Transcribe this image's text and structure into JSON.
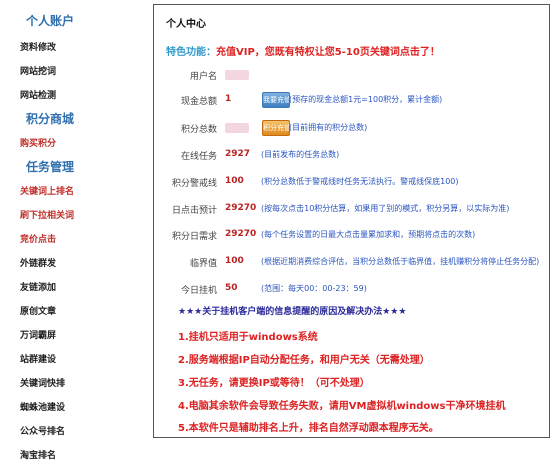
{
  "sidebar": {
    "sections": [
      {
        "title": "个人账户",
        "items": [
          {
            "label": "资料修改",
            "highlight": false
          },
          {
            "label": "网站挖词",
            "highlight": false
          },
          {
            "label": "网站检测",
            "highlight": false
          }
        ]
      },
      {
        "title": "积分商城",
        "items": [
          {
            "label": "购买积分",
            "highlight": true
          }
        ]
      },
      {
        "title": "任务管理",
        "items": [
          {
            "label": "关键词上排名",
            "highlight": true
          },
          {
            "label": "刷下拉相关词",
            "highlight": true
          },
          {
            "label": "竞价点击",
            "highlight": true
          },
          {
            "label": "外链群发",
            "highlight": false
          },
          {
            "label": "友链添加",
            "highlight": false
          },
          {
            "label": "原创文章",
            "highlight": false
          },
          {
            "label": "万词霸屏",
            "highlight": false
          },
          {
            "label": "站群建设",
            "highlight": false
          },
          {
            "label": "关键词快排",
            "highlight": false
          },
          {
            "label": "蜘蛛池建设",
            "highlight": false
          },
          {
            "label": "公众号排名",
            "highlight": false
          },
          {
            "label": "淘宝排名",
            "highlight": false
          }
        ]
      }
    ]
  },
  "panel": {
    "title": "个人中心",
    "feature_label": "特色功能：",
    "feature_text": "充值VIP，您既有特权让您5-10页关键词点击了！",
    "rows": {
      "username": {
        "label": "用户名",
        "value": ""
      },
      "cash": {
        "label": "现金总额",
        "value": "1",
        "button": "我要充值",
        "desc": "(预存的现金总额1元=100积分，累计金额)"
      },
      "points": {
        "label": "积分总数",
        "value": "",
        "button": "积分充值",
        "desc": "(目前拥有的积分总数)"
      },
      "online_tasks": {
        "label": "在线任务",
        "value": "2927",
        "desc": "(目前发布的任务总数)"
      },
      "alert_line": {
        "label": "积分警戒线",
        "value": "100",
        "desc": "(积分总数低于警戒线时任务无法执行。警戒线保底100)"
      },
      "daily_estimate": {
        "label": "日点击预计",
        "value": "29270",
        "desc": "(按每次点击10积分估算，如果用了别的模式，积分另算，以实际为准)"
      },
      "daily_need": {
        "label": "积分日需求",
        "value": "29270",
        "desc": "(每个任务设置的日最大点击量累加求和，预期将点击的次数)"
      },
      "critical": {
        "label": "临界值",
        "value": "100",
        "desc": "(根据近期消费综合评估，当积分总数低于临界值，挂机赚积分将停止任务分配)"
      },
      "hangup_today": {
        "label": "今日挂机",
        "value": "50",
        "desc": "(范围：每天00：00-23：59)"
      }
    },
    "notice_title": "★★★关于挂机客户端的信息提醒的原因及解决办法★★★",
    "tips": [
      "1.挂机只适用于windows系统",
      "2.服务端根据IP自动分配任务，和用户无关（无需处理）",
      "3.无任务，请更换IP或等待！（可不处理）",
      "4.电脑其余软件会导致任务失败，请用VM虚拟机windows干净环境挂机",
      "5.本软件只是辅助排名上升，排名自然浮动跟本程序无关。"
    ]
  }
}
